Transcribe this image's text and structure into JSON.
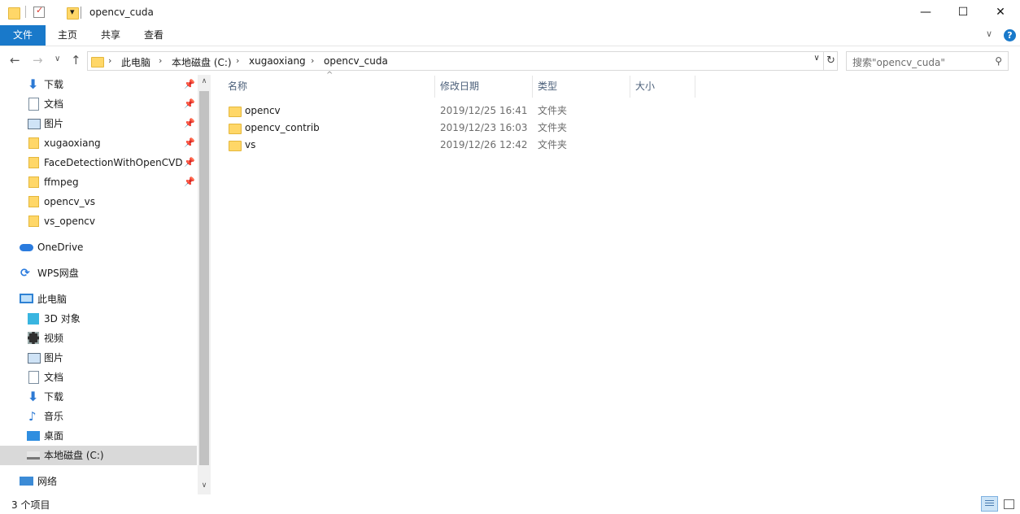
{
  "window": {
    "title": "opencv_cuda",
    "minimize_glyph": "—",
    "maximize_glyph": "☐",
    "close_glyph": "✕"
  },
  "quick_access_toolbar": {
    "dropdown_glyph": "▾",
    "icons": [
      "folder-icon",
      "properties-icon",
      "new-folder-icon"
    ]
  },
  "ribbon": {
    "tabs": [
      "文件",
      "主页",
      "共享",
      "查看"
    ],
    "expand_glyph": "∨",
    "help_glyph": "?"
  },
  "nav": {
    "back_glyph": "←",
    "forward_glyph": "→",
    "recent_glyph": "∨",
    "up_glyph": "↑"
  },
  "address": {
    "crumbs": [
      "此电脑",
      "本地磁盘 (C:)",
      "xugaoxiang",
      "opencv_cuda"
    ],
    "separator": "›",
    "dropdown_glyph": "∨",
    "refresh_glyph": "↻"
  },
  "search": {
    "placeholder": "搜索\"opencv_cuda\"",
    "icon_glyph": "⚲"
  },
  "sidebar": {
    "quick_access": [
      {
        "label": "下载",
        "icon": "download-icon",
        "pinned": true
      },
      {
        "label": "文档",
        "icon": "document-icon",
        "pinned": true
      },
      {
        "label": "图片",
        "icon": "pictures-icon",
        "pinned": true
      },
      {
        "label": "xugaoxiang",
        "icon": "folder-icon",
        "pinned": true
      },
      {
        "label": "FaceDetectionWithOpenCVDNN",
        "icon": "folder-icon",
        "pinned": true
      },
      {
        "label": "ffmpeg",
        "icon": "folder-icon",
        "pinned": true
      },
      {
        "label": "opencv_vs",
        "icon": "folder-icon",
        "pinned": false
      },
      {
        "label": "vs_opencv",
        "icon": "folder-icon",
        "pinned": false
      }
    ],
    "onedrive": "OneDrive",
    "wps": "WPS网盘",
    "this_pc": "此电脑",
    "pc_items": [
      {
        "label": "3D 对象",
        "icon": "3d-objects-icon"
      },
      {
        "label": "视频",
        "icon": "videos-icon"
      },
      {
        "label": "图片",
        "icon": "pictures-icon"
      },
      {
        "label": "文档",
        "icon": "document-icon"
      },
      {
        "label": "下载",
        "icon": "download-icon"
      },
      {
        "label": "音乐",
        "icon": "music-icon"
      },
      {
        "label": "桌面",
        "icon": "desktop-icon"
      },
      {
        "label": "本地磁盘 (C:)",
        "icon": "drive-icon",
        "selected": true
      }
    ],
    "network": "网络",
    "pin_glyph": "📌",
    "scroll_up_glyph": "∧",
    "scroll_down_glyph": "∨"
  },
  "columns": {
    "name": "名称",
    "modified": "修改日期",
    "type": "类型",
    "size": "大小",
    "sort_glyph": "^"
  },
  "files": [
    {
      "name": "opencv",
      "modified": "2019/12/25 16:41",
      "type": "文件夹"
    },
    {
      "name": "opencv_contrib",
      "modified": "2019/12/23 16:03",
      "type": "文件夹"
    },
    {
      "name": "vs",
      "modified": "2019/12/26 12:42",
      "type": "文件夹"
    }
  ],
  "status": {
    "item_count": "3 个项目"
  }
}
